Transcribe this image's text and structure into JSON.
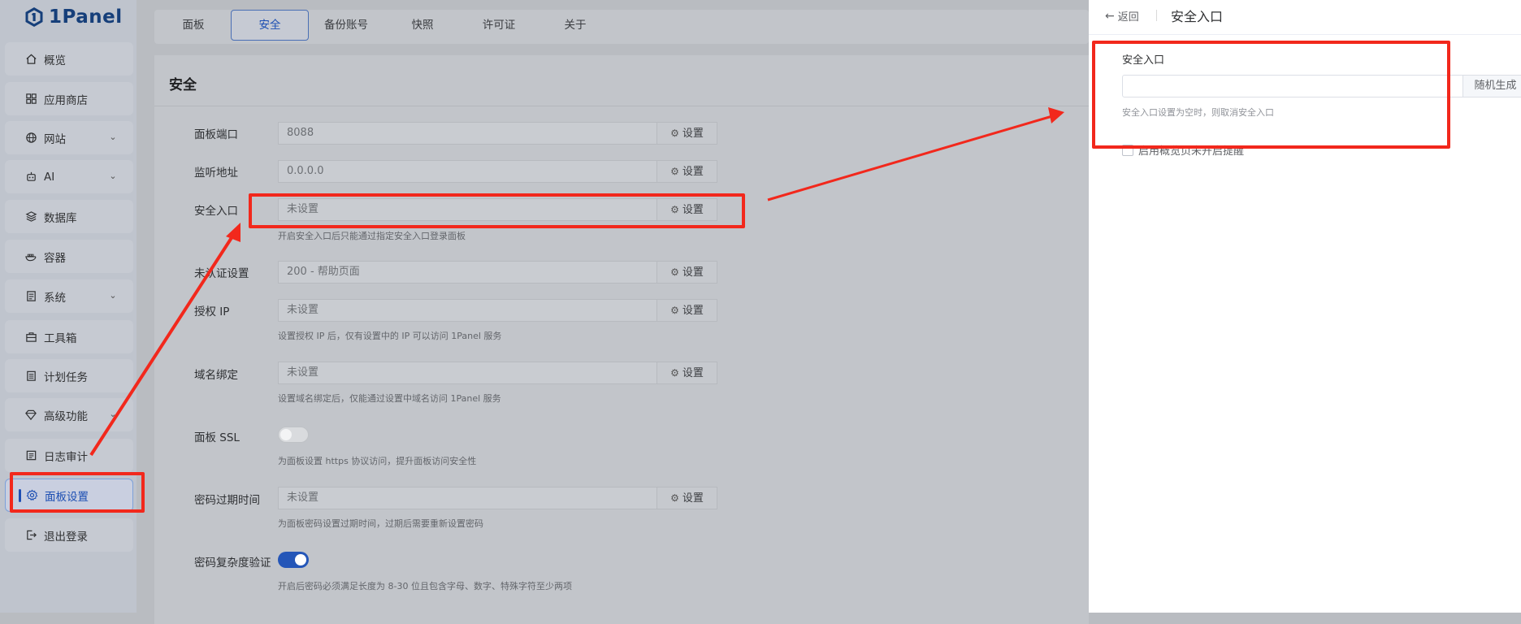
{
  "app": {
    "logo_text": "1Panel"
  },
  "sidebar": {
    "items": [
      {
        "label": "概览",
        "icon": "home-icon"
      },
      {
        "label": "应用商店",
        "icon": "grid-icon"
      },
      {
        "label": "网站",
        "icon": "globe-icon",
        "expandable": true
      },
      {
        "label": "AI",
        "icon": "robot-icon",
        "expandable": true
      },
      {
        "label": "数据库",
        "icon": "layers-icon"
      },
      {
        "label": "容器",
        "icon": "whale-icon"
      },
      {
        "label": "系统",
        "icon": "server-icon",
        "expandable": true
      },
      {
        "label": "工具箱",
        "icon": "toolbox-icon"
      },
      {
        "label": "计划任务",
        "icon": "calendar-icon"
      },
      {
        "label": "高级功能",
        "icon": "diamond-icon",
        "expandable": true
      },
      {
        "label": "日志审计",
        "icon": "log-icon"
      },
      {
        "label": "面板设置",
        "icon": "gear-icon",
        "active": true
      },
      {
        "label": "退出登录",
        "icon": "logout-icon"
      }
    ]
  },
  "tabs": [
    "面板",
    "安全",
    "备份账号",
    "快照",
    "许可证",
    "关于"
  ],
  "active_tab": "安全",
  "main": {
    "title": "安全",
    "set_label": "设置",
    "rows": {
      "port": {
        "label": "面板端口",
        "value": "8088"
      },
      "listen": {
        "label": "监听地址",
        "value": "0.0.0.0"
      },
      "entrance": {
        "label": "安全入口",
        "value": "未设置",
        "help": "开启安全入口后只能通过指定安全入口登录面板"
      },
      "unauth": {
        "label": "未认证设置",
        "value": "200 - 帮助页面"
      },
      "allow_ip": {
        "label": "授权 IP",
        "value": "未设置",
        "help": "设置授权 IP 后，仅有设置中的 IP 可以访问 1Panel 服务"
      },
      "domain": {
        "label": "域名绑定",
        "value": "未设置",
        "help": "设置域名绑定后，仅能通过设置中域名访问 1Panel 服务"
      },
      "ssl": {
        "label": "面板 SSL",
        "enabled": false,
        "help": "为面板设置 https 协议访问，提升面板访问安全性"
      },
      "expire": {
        "label": "密码过期时间",
        "value": "未设置",
        "help": "为面板密码设置过期时间，过期后需要重新设置密码"
      },
      "complexity": {
        "label": "密码复杂度验证",
        "enabled": true,
        "help": "开启后密码必须满足长度为 8-30 位且包含字母、数字、特殊字符至少两项"
      }
    }
  },
  "drawer": {
    "back_label": "返回",
    "title": "安全入口",
    "field_label": "安全入口",
    "input_value": "",
    "random_button": "随机生成",
    "help": "安全入口设置为空时，则取消安全入口",
    "checkbox_label": "启用概览页未开启提醒",
    "checkbox_checked": false
  },
  "colors": {
    "annotation": "#f2281c",
    "accent": "#1d4fb3"
  }
}
